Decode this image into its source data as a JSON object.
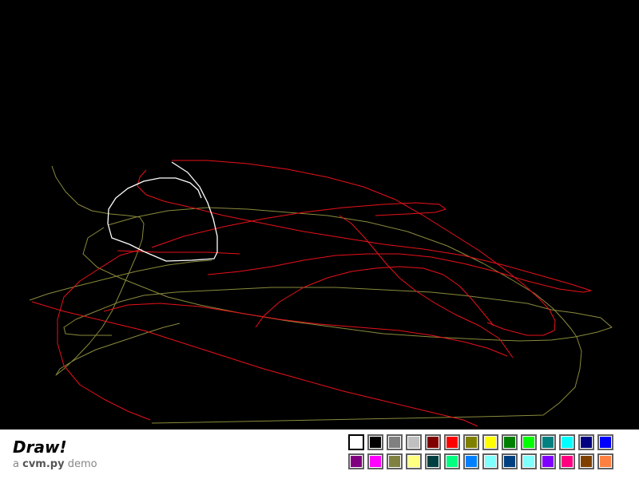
{
  "app": {
    "title": "Draw!",
    "subtitle_prefix": "a ",
    "subtitle_brand": "cvm.py",
    "subtitle_suffix": " demo"
  },
  "canvas": {
    "background": "#000000"
  },
  "palette": {
    "selected_index": 0,
    "colors": [
      "#ffffff",
      "#000000",
      "#808080",
      "#c0c0c0",
      "#800000",
      "#ff0000",
      "#808000",
      "#ffff00",
      "#008000",
      "#00ff00",
      "#008080",
      "#00ffff",
      "#000080",
      "#0000ff",
      "#800080",
      "#ff00ff",
      "#808040",
      "#ffff80",
      "#004040",
      "#00ff80",
      "#0080ff",
      "#80ffff",
      "#004080",
      "#80ffff",
      "#8000ff",
      "#ff0080",
      "#804000",
      "#ff8040"
    ]
  }
}
